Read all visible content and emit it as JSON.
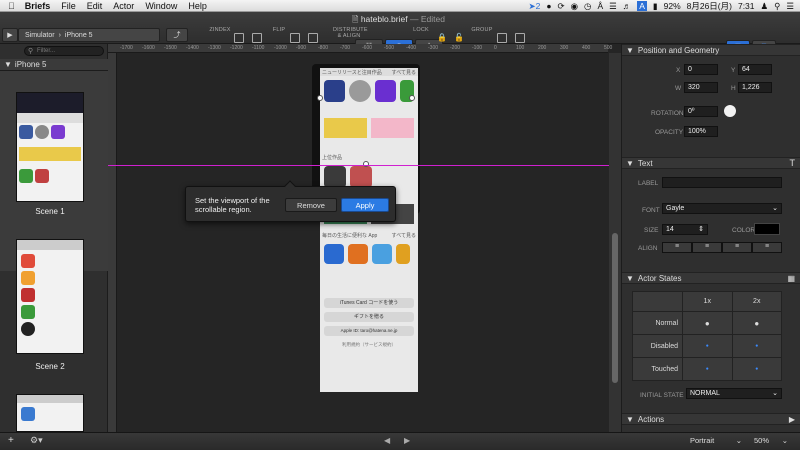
{
  "menubar": {
    "app": "Briefs",
    "items": [
      "File",
      "Edit",
      "Actor",
      "Window",
      "Help"
    ],
    "battery": "92%",
    "date": "8月26日(月)",
    "time": "7:31",
    "notif_count": "2"
  },
  "window": {
    "title": "hateblo.brief",
    "status": "— Edited"
  },
  "toolbar": {
    "simulator": "Simulator",
    "device": "iPhone 5",
    "groups": [
      "ZINDEX",
      "FLIP",
      "DISTRIBUTE & ALIGN",
      "LOCK",
      "GROUP"
    ]
  },
  "sidebar": {
    "device": "iPhone 5",
    "filter_placeholder": "Filter...",
    "scenes": [
      "Scene 1",
      "Scene 2"
    ]
  },
  "canvas": {
    "ruler_ticks": [
      "-1700",
      "-1600",
      "-1500",
      "-1400",
      "-1300",
      "-1200",
      "-1100",
      "-1000",
      "-900",
      "-800",
      "-700",
      "-600",
      "-500",
      "-400",
      "-300",
      "-200",
      "-100",
      "0",
      "100",
      "200",
      "300",
      "400",
      "500"
    ],
    "preview": {
      "section1": "ニューリリースと注目作品",
      "section1_more": "すべて見る",
      "section2": "上位作品",
      "section3": "毎日の生活に便利な App",
      "section3_more": "すべて見る",
      "btn1": "iTunes Card コードを使う",
      "btn2": "ギフトを贈る",
      "apple_id": "Apple ID: taro@hatena.ne.jp",
      "terms": "利用規約（サービス規約）"
    }
  },
  "popover": {
    "message_line1": "Set the viewport of the",
    "message_line2": "scrollable region.",
    "remove": "Remove",
    "apply": "Apply"
  },
  "inspector": {
    "position_title": "Position and Geometry",
    "x_label": "X",
    "x": "0",
    "y_label": "Y",
    "y": "64",
    "w_label": "W",
    "w": "320",
    "h_label": "H",
    "h": "1,226",
    "rotation_label": "ROTATION",
    "rotation": "0º",
    "opacity_label": "OPACITY",
    "opacity": "100%",
    "text_title": "Text",
    "label_label": "LABEL",
    "font_label": "FONT",
    "font": "Gayle",
    "size_label": "SIZE",
    "size": "14",
    "color_label": "COLOR",
    "align_label": "ALIGN",
    "actor_states_title": "Actor States",
    "states_cols": [
      "1x",
      "2x"
    ],
    "states_rows": [
      "Normal",
      "Disabled",
      "Touched"
    ],
    "initial_state_label": "INITIAL STATE",
    "initial_state": "NORMAL",
    "actions_title": "Actions"
  },
  "bottombar": {
    "orientation": "Portrait",
    "zoom": "50%"
  },
  "colors": {
    "accent": "#2b7be4",
    "guide": "#d020d0",
    "bg": "#252525"
  }
}
